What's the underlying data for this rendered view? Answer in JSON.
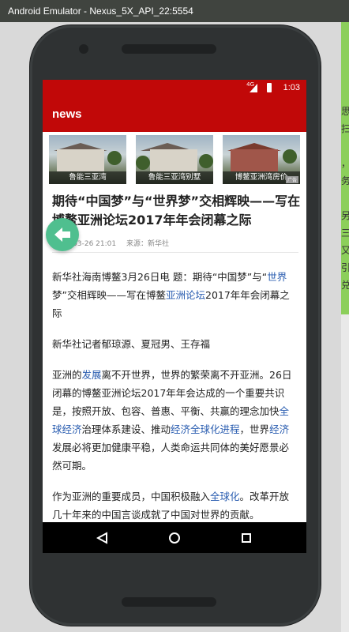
{
  "window": {
    "title": "Android Emulator - Nexus_5X_API_22:5554"
  },
  "status_bar": {
    "time": "1:03",
    "network": "4G"
  },
  "app_bar": {
    "title": "news"
  },
  "carousel": [
    {
      "caption": "鲁能三亚湾"
    },
    {
      "caption": "鲁能三亚湾别墅"
    },
    {
      "caption": "博鳌亚洲湾房价"
    }
  ],
  "ad_tag": "广告",
  "article": {
    "title": "期待“中国梦”与“世界梦”交相辉映——写在博鳌亚洲论坛2017年年会闭幕之际",
    "date": "2017-03-26 21:01",
    "source": "来源：新华社",
    "paragraphs": [
      [
        {
          "t": "新华社海南博鳌3月26日电  题：期待“中国梦”与“"
        },
        {
          "t": "世界",
          "link": true
        },
        {
          "t": "梦”交相辉映——写在博鳌"
        },
        {
          "t": "亚洲论坛",
          "link": true
        },
        {
          "t": "2017年年会闭幕之际"
        }
      ],
      [
        {
          "t": "新华社记者郁琼源、夏冠男、王存福"
        }
      ],
      [
        {
          "t": "亚洲的"
        },
        {
          "t": "发展",
          "link": true
        },
        {
          "t": "离不开世界，世界的繁荣离不开亚洲。26日闭幕的博鳌亚洲论坛2017年年会达成的一个重要共识是，按照开放、包容、普惠、平衡、共赢的理念加快"
        },
        {
          "t": "全球经济",
          "link": true
        },
        {
          "t": "治理体系建设、推动"
        },
        {
          "t": "经济全球化进程",
          "link": true
        },
        {
          "t": "，世界"
        },
        {
          "t": "经济",
          "link": true
        },
        {
          "t": "发展必将更加健康平稳，人类命运共同体的美好愿景必然可期。"
        }
      ],
      [
        {
          "t": "作为亚洲的重要成员，中国积极融入"
        },
        {
          "t": "全球化",
          "link": true
        },
        {
          "t": "。改革开放几十年来的中国言谈成就了中国对世界的贡献。"
        }
      ]
    ]
  },
  "side_peek": "思\n扫\n\n，\n务\n\n另\n三\n又\n引\n兑",
  "icons": {
    "back": "arrow-left-icon",
    "nav_back": "triangle-back-icon",
    "nav_home": "circle-home-icon",
    "nav_recents": "square-recents-icon"
  },
  "colors": {
    "primary": "#c10808",
    "link": "#2a5db0",
    "fab": "#4fbf8f"
  }
}
